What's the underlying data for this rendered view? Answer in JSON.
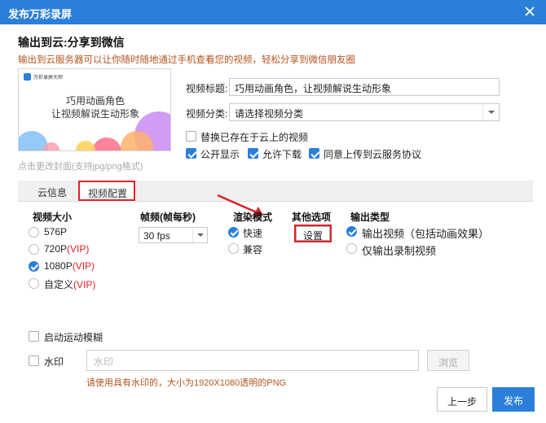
{
  "window": {
    "title": "发布万彩录屏"
  },
  "header": {
    "title": "输出到云:分享到微信",
    "subtitle": "输出到云服务器可以让你随时随地通过手机查看您的视频，轻松分享到微信朋友圈"
  },
  "cover": {
    "logo_text": "万彩录屏大师",
    "line1": "巧用动画角色",
    "line2": "让视频解说生动形象",
    "hint": "点击更改封面(支持jpg/png格式)"
  },
  "form": {
    "title_label": "视频标题:",
    "title_value": "巧用动画角色，让视频解说生动形象",
    "category_label": "视频分类:",
    "category_value": "请选择视频分类",
    "replace_label": "替换已存在于云上的视频",
    "replace_checked": false,
    "public_label": "公开显示",
    "public_checked": true,
    "download_label": "允许下载",
    "download_checked": true,
    "agree_label": "同意上传到云服务协议",
    "agree_checked": true
  },
  "tabs": [
    {
      "label": "云信息",
      "active": false
    },
    {
      "label": "视频配置",
      "active": true
    }
  ],
  "video_size": {
    "header": "视频大小",
    "options": [
      {
        "label": "576P",
        "vip": "",
        "checked": false
      },
      {
        "label": "720P",
        "vip": "(VIP)",
        "checked": false
      },
      {
        "label": "1080P",
        "vip": "(VIP)",
        "checked": true
      },
      {
        "label": "自定义",
        "vip": "(VIP)",
        "checked": false
      }
    ]
  },
  "framerate": {
    "header": "帧频(帧每秒)",
    "value": "30 fps"
  },
  "render_mode": {
    "header": "渲染模式",
    "options": [
      {
        "label": "快速",
        "checked": true
      },
      {
        "label": "兼容",
        "checked": false
      }
    ]
  },
  "other_options": {
    "header": "其他选项",
    "button": "设置"
  },
  "output_type": {
    "header": "输出类型",
    "options": [
      {
        "label": "输出视频（包括动画效果）",
        "checked": true
      },
      {
        "label": "仅输出录制视频",
        "checked": false
      }
    ]
  },
  "motion_blur": {
    "label": "启动运动模糊",
    "checked": false
  },
  "watermark": {
    "label": "水印",
    "checked": false,
    "placeholder": "水印",
    "browse": "浏览",
    "note": "请使用具有水印的，大小为1920X1080透明的PNG"
  },
  "footer": {
    "prev": "上一步",
    "publish": "发布"
  },
  "colors": {
    "accent": "#2b7fd9",
    "highlight": "#e0202a",
    "note": "#b3541e"
  }
}
